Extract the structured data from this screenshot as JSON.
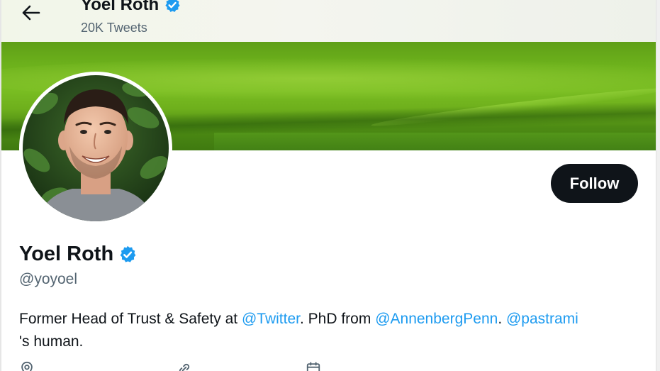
{
  "header": {
    "name": "Yoel Roth",
    "tweet_count": "20K Tweets",
    "back_icon": "arrow-left-icon",
    "verified_icon": "verified-badge-icon"
  },
  "banner": {
    "description_icon": "landscape-banner"
  },
  "profile": {
    "display_name": "Yoel Roth",
    "handle": "@yoyoel",
    "follow_label": "Follow",
    "bio": {
      "text1": "Former Head of Trust & Safety at ",
      "link1": "@Twitter",
      "text2": ". PhD from ",
      "link2": "@AnnenbergPenn",
      "text3": ". ",
      "link3": "@pastrami",
      "text4": "'s human."
    },
    "meta": {
      "location_icon": "location-pin-icon",
      "link_icon": "link-icon",
      "calendar_icon": "calendar-icon"
    }
  },
  "colors": {
    "accent": "#1d9bf0",
    "text": "#0f1419",
    "secondary": "#536471",
    "button_bg": "#0f1419"
  }
}
